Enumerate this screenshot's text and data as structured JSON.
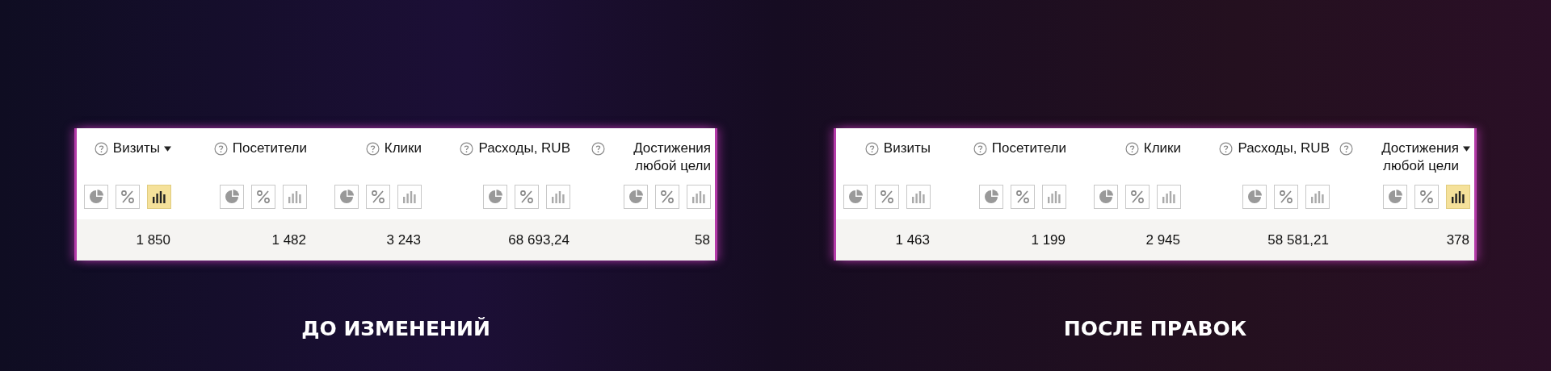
{
  "panels": [
    {
      "caption": "ДО ИЗМЕНЕНИЙ",
      "columns": [
        {
          "title": "Визиты",
          "sorted": true,
          "value": "1 850",
          "views": [
            {
              "kind": "pie",
              "selected": false
            },
            {
              "kind": "percent",
              "selected": false
            },
            {
              "kind": "bars",
              "selected": true
            }
          ]
        },
        {
          "title": "Посетители",
          "sorted": false,
          "value": "1 482",
          "views": [
            {
              "kind": "pie",
              "selected": false
            },
            {
              "kind": "percent",
              "selected": false
            },
            {
              "kind": "bars",
              "selected": false
            }
          ]
        },
        {
          "title": "Клики",
          "sorted": false,
          "value": "3 243",
          "views": [
            {
              "kind": "pie",
              "selected": false
            },
            {
              "kind": "percent",
              "selected": false
            },
            {
              "kind": "bars",
              "selected": false
            }
          ]
        },
        {
          "title": "Расходы, RUB",
          "sorted": false,
          "value": "68 693,24",
          "views": [
            {
              "kind": "pie",
              "selected": false
            },
            {
              "kind": "percent",
              "selected": false
            },
            {
              "kind": "bars",
              "selected": false
            }
          ]
        },
        {
          "title": "Достижения любой цели",
          "sorted": false,
          "value": "58",
          "views": [
            {
              "kind": "pie",
              "selected": false
            },
            {
              "kind": "percent",
              "selected": false
            },
            {
              "kind": "bars",
              "selected": false
            }
          ]
        }
      ]
    },
    {
      "caption": "ПОСЛЕ ПРАВОК",
      "columns": [
        {
          "title": "Визиты",
          "sorted": false,
          "value": "1 463",
          "views": [
            {
              "kind": "pie",
              "selected": false
            },
            {
              "kind": "percent",
              "selected": false
            },
            {
              "kind": "bars",
              "selected": false
            }
          ]
        },
        {
          "title": "Посетители",
          "sorted": false,
          "value": "1 199",
          "views": [
            {
              "kind": "pie",
              "selected": false
            },
            {
              "kind": "percent",
              "selected": false
            },
            {
              "kind": "bars",
              "selected": false
            }
          ]
        },
        {
          "title": "Клики",
          "sorted": false,
          "value": "2 945",
          "views": [
            {
              "kind": "pie",
              "selected": false
            },
            {
              "kind": "percent",
              "selected": false
            },
            {
              "kind": "bars",
              "selected": false
            }
          ]
        },
        {
          "title": "Расходы, RUB",
          "sorted": false,
          "value": "58 581,21",
          "views": [
            {
              "kind": "pie",
              "selected": false
            },
            {
              "kind": "percent",
              "selected": false
            },
            {
              "kind": "bars",
              "selected": false
            }
          ]
        },
        {
          "title": "Достижения любой цели",
          "sorted": true,
          "value": "378",
          "views": [
            {
              "kind": "pie",
              "selected": false
            },
            {
              "kind": "percent",
              "selected": false
            },
            {
              "kind": "bars",
              "selected": true
            }
          ]
        }
      ]
    }
  ]
}
